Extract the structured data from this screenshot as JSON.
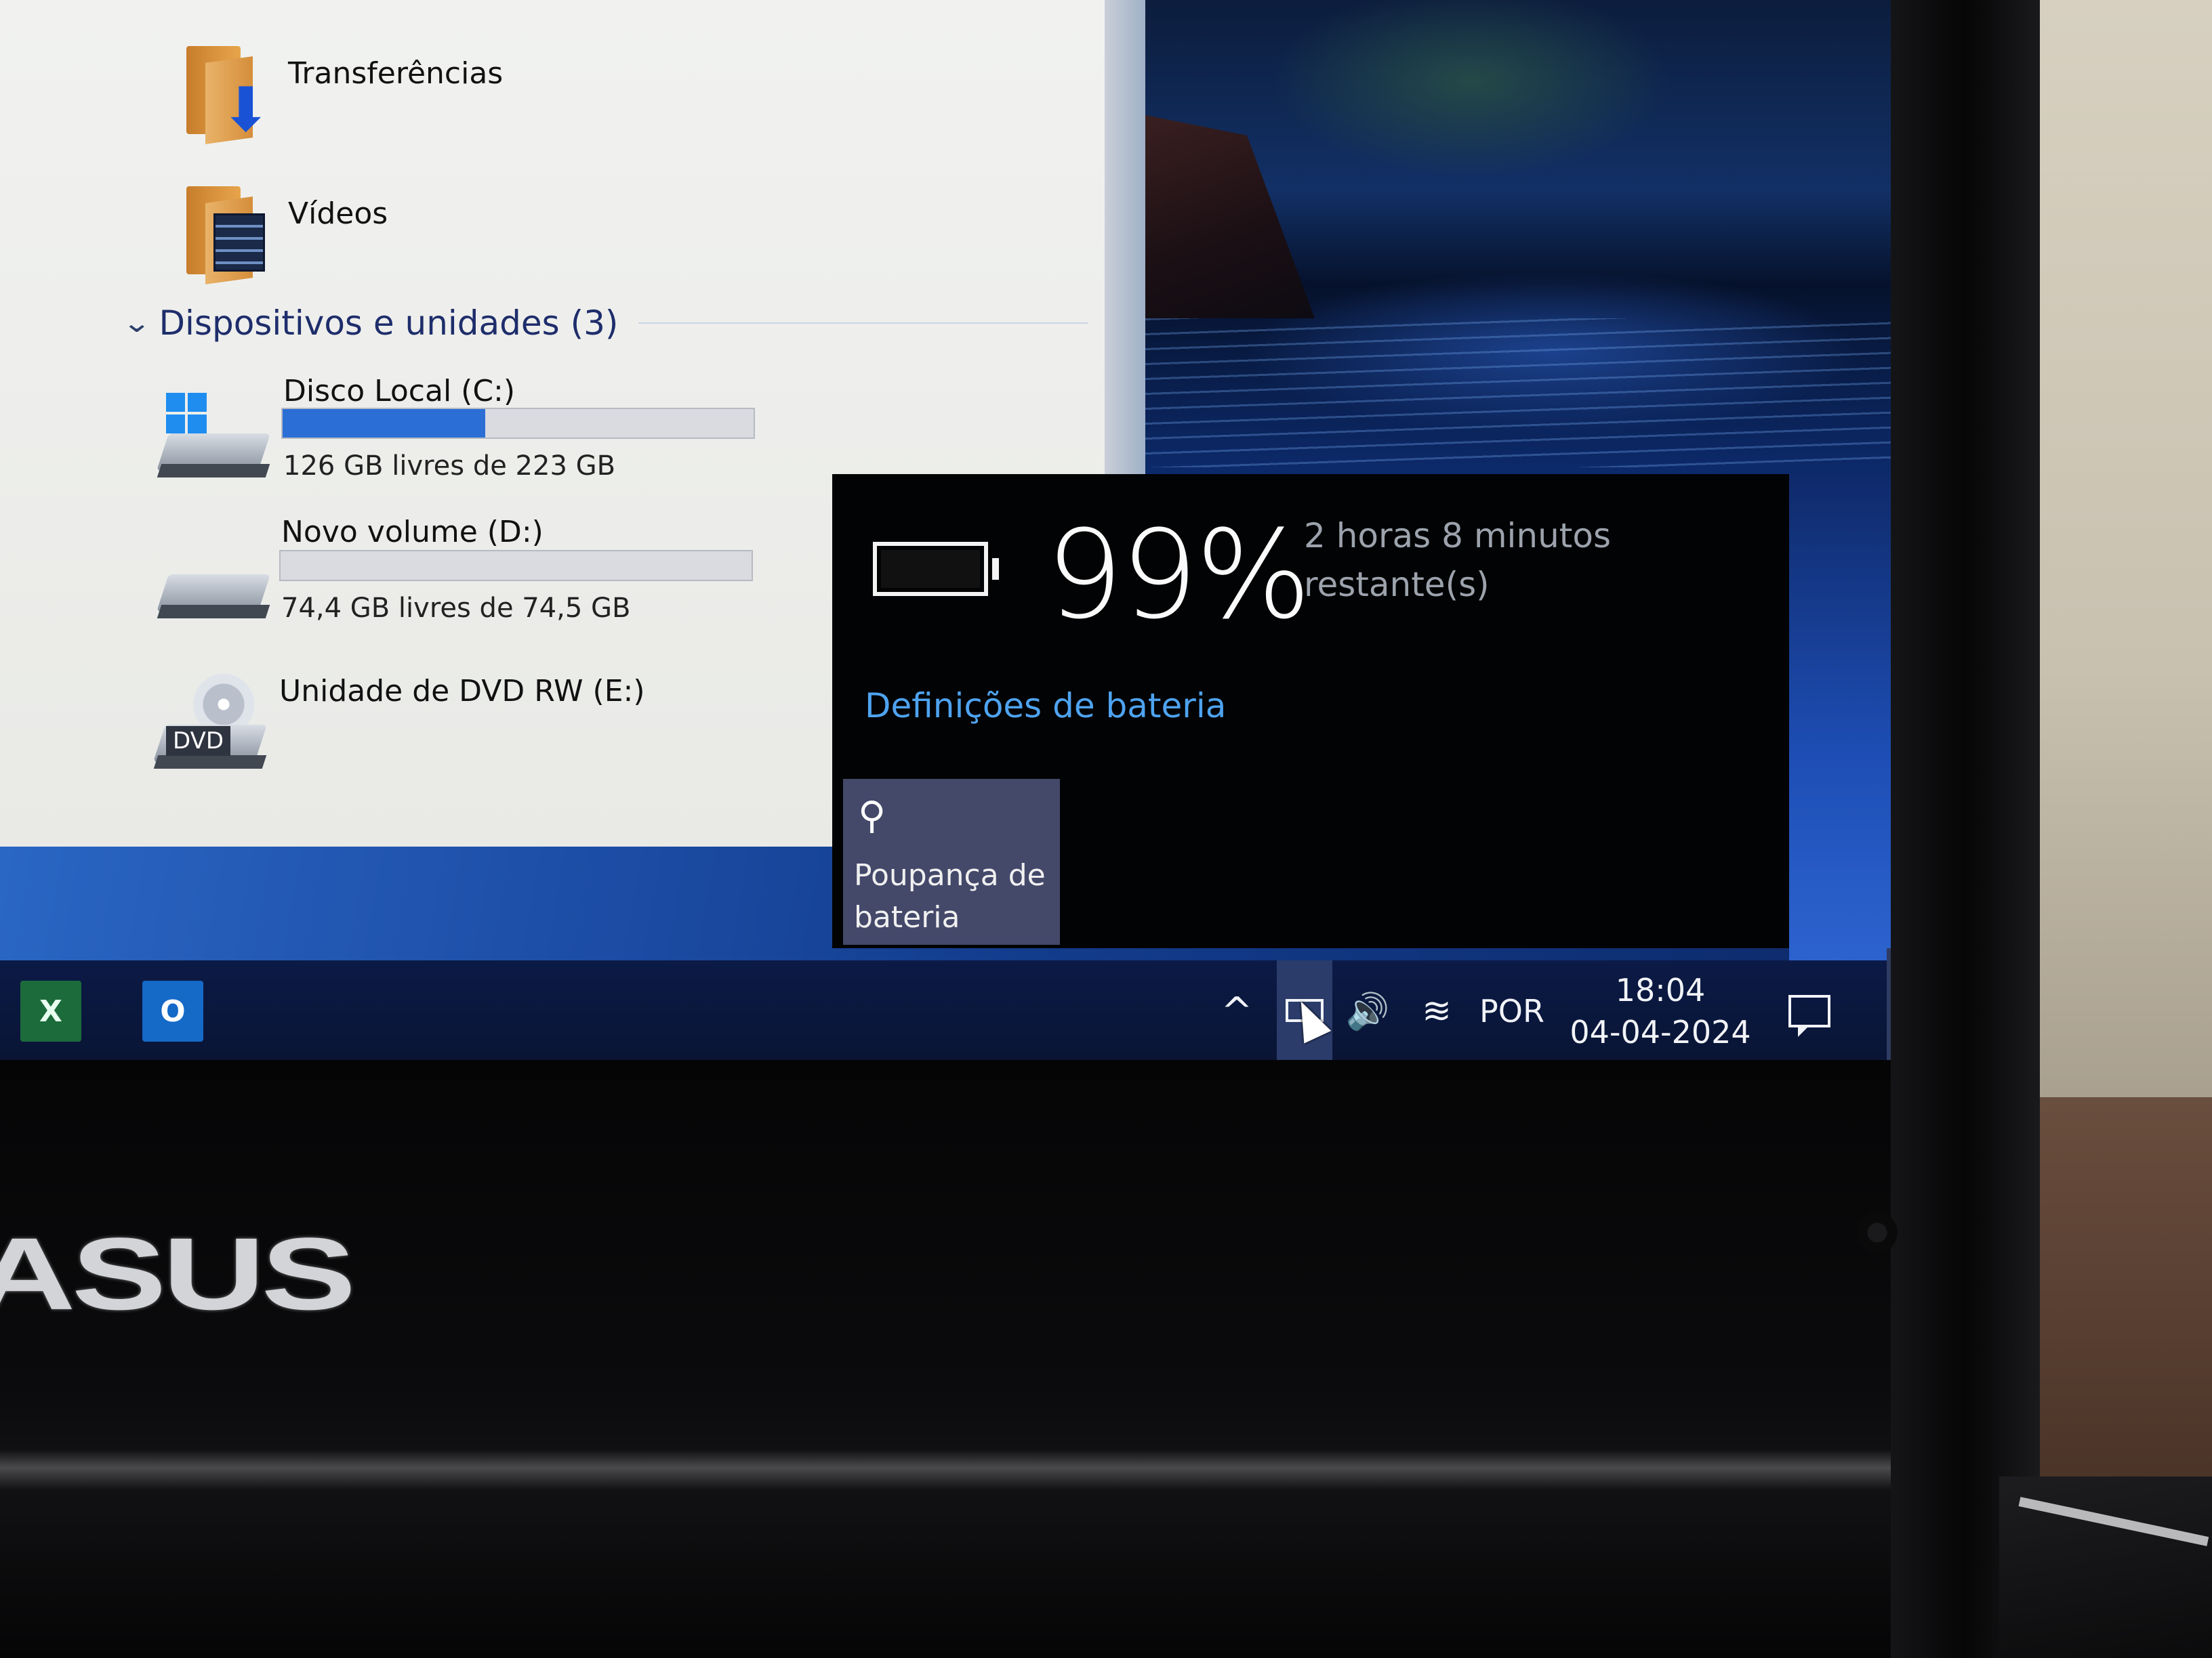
{
  "explorer": {
    "folders": [
      {
        "label": "Transferências",
        "icon": "downloads-folder-icon"
      },
      {
        "label": "Vídeos",
        "icon": "videos-folder-icon"
      }
    ],
    "devices_header": "Dispositivos e unidades (3)",
    "drives": [
      {
        "name": "Disco Local (C:)",
        "free_text": "126 GB livres de 223 GB",
        "used_fraction": 0.43,
        "icon": "system-drive-icon"
      },
      {
        "name": "Novo volume (D:)",
        "free_text": "74,4 GB livres de 74,5 GB",
        "used_fraction": 0.0,
        "icon": "hard-drive-icon"
      },
      {
        "name": "Unidade de DVD RW (E:)",
        "dvd_label": "DVD",
        "icon": "dvd-drive-icon"
      }
    ]
  },
  "battery_flyout": {
    "percent": "99%",
    "percent_value": 99,
    "remaining": "2 horas 8 minutos restante(s)",
    "settings_link": "Definições de bateria",
    "saver_tile_label": "Poupança de bateria",
    "link_color": "#4ea3f0",
    "tile_color": "#44496a"
  },
  "taskbar": {
    "apps": [
      {
        "name": "excel",
        "glyph": "X"
      },
      {
        "name": "outlook",
        "glyph": "O"
      }
    ],
    "tray": {
      "chevron": "^",
      "language": "POR",
      "time": "18:04",
      "date": "04-04-2024"
    }
  },
  "hardware": {
    "brand": "ASUS"
  }
}
